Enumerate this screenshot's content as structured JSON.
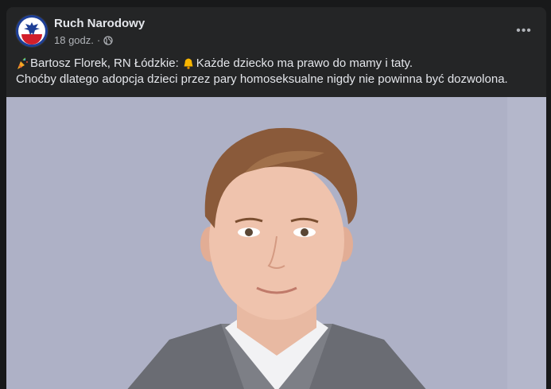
{
  "post": {
    "author": "Ruch Narodowy",
    "timestamp": "18 godz.",
    "separator": "·",
    "audience_icon": "globe-icon",
    "more_icon": "more-options-icon",
    "more_label": "•••",
    "text": {
      "line1_part1": "Bartosz Florek, RN Łódzkie:",
      "line1_part2": "Każde dziecko ma prawo do mamy i taty.",
      "line2": "Choćby dlatego adopcja dzieci przez pary homoseksualne nigdy nie powinna być dozwolona."
    },
    "emojis": [
      "party-popper-icon",
      "bell-icon"
    ]
  },
  "colors": {
    "page_bg": "#18191a",
    "card_bg": "#242526",
    "primary_text": "#e4e6eb",
    "secondary_text": "#b0b3b8",
    "avatar_bg": "#1a3a8a"
  }
}
